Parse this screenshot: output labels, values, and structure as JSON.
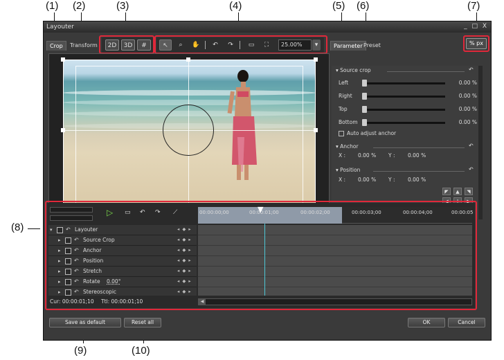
{
  "callouts": [
    "(1)",
    "(2)",
    "(3)",
    "(4)",
    "(5)",
    "(6)",
    "(7)",
    "(8)",
    "(9)",
    "(10)"
  ],
  "window": {
    "title": "Layouter",
    "controls": "_ □ X"
  },
  "tabs": {
    "crop": "Crop",
    "transform": "Transform",
    "parameter": "Parameter",
    "preset": "Preset"
  },
  "mode_buttons": {
    "mode_2d": "2D",
    "mode_3d": "3D",
    "mode_grid": "#"
  },
  "toolbar": {
    "zoom_value": "25.00%"
  },
  "unit_toggle": {
    "percent": "%",
    "px": "px"
  },
  "source_crop": {
    "title": "Source crop",
    "rows": [
      {
        "label": "Left",
        "value": "0.00 %"
      },
      {
        "label": "Right",
        "value": "0.00 %"
      },
      {
        "label": "Top",
        "value": "0.00 %"
      },
      {
        "label": "Bottom",
        "value": "0.00 %"
      }
    ],
    "auto_adjust_label": "Auto adjust anchor"
  },
  "anchor": {
    "title": "Anchor",
    "x_label": "X :",
    "x_value": "0.00 %",
    "y_label": "Y :",
    "y_value": "0.00 %"
  },
  "position": {
    "title": "Position",
    "x_label": "X :",
    "x_value": "0.00 %",
    "y_label": "Y :",
    "y_value": "0.00 %"
  },
  "timeline": {
    "ruler_labels": [
      "00:00:00;00",
      "00:00:01;00",
      "00:00:02;00",
      "00:00:03;00",
      "00:00:04;00",
      "00:00:05"
    ],
    "tracks": [
      {
        "name": "Layouter",
        "extra": ""
      },
      {
        "name": "Source Crop",
        "extra": ""
      },
      {
        "name": "Anchor",
        "extra": ""
      },
      {
        "name": "Position",
        "extra": ""
      },
      {
        "name": "Stretch",
        "extra": ""
      },
      {
        "name": "Rotate",
        "extra": "0.00°"
      },
      {
        "name": "Stereoscopic",
        "extra": ""
      }
    ],
    "cur": "Cur: 00:00:01;10",
    "ttl": "Ttl: 00:00:01;10"
  },
  "footer": {
    "save_default": "Save as default",
    "reset_all": "Reset all",
    "ok": "OK",
    "cancel": "Cancel"
  },
  "colors": {
    "callout_box": "#e0283a",
    "playhead": "#4fc7d6"
  }
}
